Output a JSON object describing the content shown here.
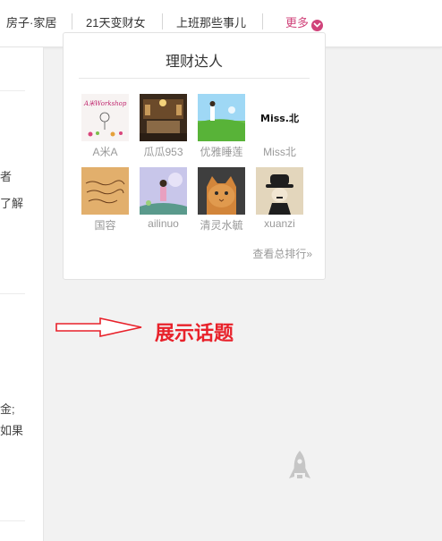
{
  "nav": {
    "items": [
      "房子·家居",
      "21天变财女",
      "上班那些事儿"
    ],
    "more_label": "更多",
    "more_icon": "chevron-down-icon",
    "accent_color": "#d0437a"
  },
  "left_column": {
    "fragments": [
      "者",
      "了解",
      "金;",
      "如果"
    ]
  },
  "card": {
    "title": "理财达人",
    "users": [
      {
        "name": "A米A",
        "avatar_icon": "workshop-avatar"
      },
      {
        "name": "瓜瓜953",
        "avatar_icon": "room-avatar"
      },
      {
        "name": "优雅睡莲",
        "avatar_icon": "meadow-avatar"
      },
      {
        "name": "Miss北",
        "avatar_icon": "miss-logo-avatar",
        "avatar_text": "Miss.北"
      },
      {
        "name": "国容",
        "avatar_icon": "handwriting-avatar"
      },
      {
        "name": "ailinuo",
        "avatar_icon": "anime-avatar"
      },
      {
        "name": "清灵水毓",
        "avatar_icon": "cat-avatar"
      },
      {
        "name": "xuanzi",
        "avatar_icon": "chaplin-avatar"
      }
    ],
    "ranking_link": "查看总排行»"
  },
  "annotation": {
    "label": "展示话题",
    "color": "#e8212a"
  },
  "back_to_top_icon": "rocket-icon"
}
